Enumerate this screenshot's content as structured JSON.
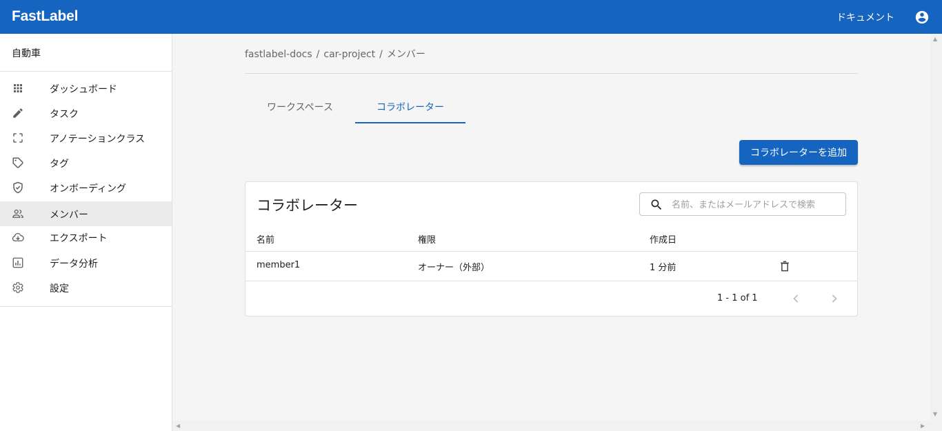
{
  "header": {
    "brand": "FastLabel",
    "doc_link": "ドキュメント",
    "account_icon": "account-circle-icon"
  },
  "sidebar": {
    "workspace": "自動車",
    "items": [
      {
        "label": "ダッシュボード",
        "icon": "apps-grid-icon"
      },
      {
        "label": "タスク",
        "icon": "pencil-icon"
      },
      {
        "label": "アノテーションクラス",
        "icon": "crop-frame-icon"
      },
      {
        "label": "タグ",
        "icon": "tag-icon"
      },
      {
        "label": "オンボーディング",
        "icon": "shield-check-icon"
      },
      {
        "label": "メンバー",
        "icon": "people-icon",
        "active": true
      },
      {
        "label": "エクスポート",
        "icon": "cloud-download-icon"
      },
      {
        "label": "データ分析",
        "icon": "bar-chart-icon"
      },
      {
        "label": "設定",
        "icon": "gear-icon"
      }
    ]
  },
  "breadcrumb": [
    "fastlabel-docs",
    "car-project",
    "メンバー"
  ],
  "tabs": [
    {
      "label": "ワークスペース",
      "active": false
    },
    {
      "label": "コラボレーター",
      "active": true
    }
  ],
  "add_button_label": "コラボレーターを追加",
  "table": {
    "title": "コラボレーター",
    "search_placeholder": "名前、またはメールアドレスで検索",
    "columns": [
      "名前",
      "権限",
      "作成日"
    ],
    "rows": [
      {
        "name": "member1",
        "role": "オーナー（外部）",
        "created": "1 分前"
      }
    ],
    "pagination": "1 - 1 of 1"
  },
  "colors": {
    "primary": "#1565c0",
    "active_nav_bg": "#ebebeb",
    "page_bg": "#f5f5f5"
  }
}
